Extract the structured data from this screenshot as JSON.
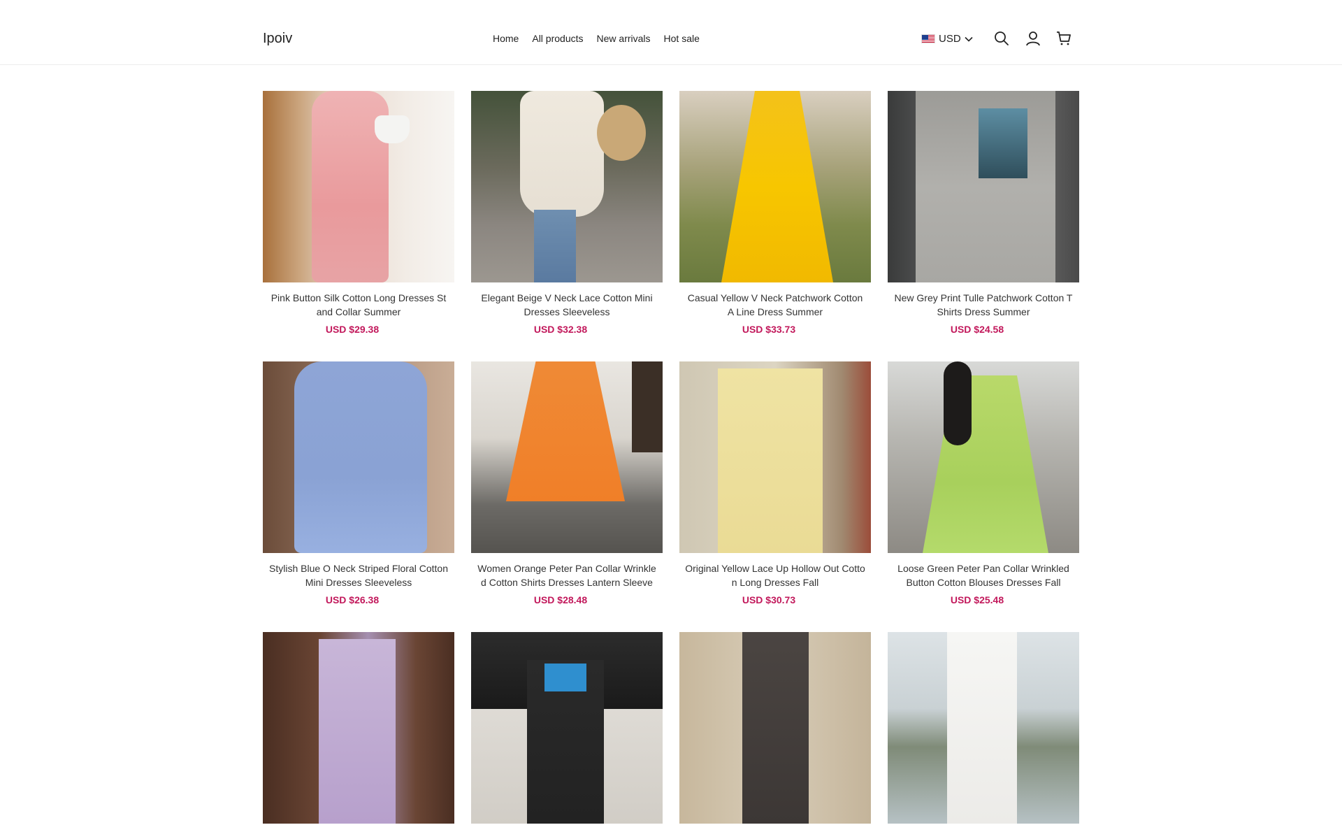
{
  "header": {
    "logo": "Ipoiv",
    "nav": [
      "Home",
      "All products",
      "New arrivals",
      "Hot sale"
    ],
    "currency": "USD",
    "icons": [
      "search-icon",
      "account-icon",
      "cart-icon"
    ]
  },
  "products": [
    {
      "title": "Pink Button Silk Cotton Long Dresses Stand Collar Summer",
      "price": "USD $29.38"
    },
    {
      "title": "Elegant Beige V Neck Lace Cotton Mini Dresses Sleeveless",
      "price": "USD $32.38"
    },
    {
      "title": "Casual Yellow V Neck Patchwork Cotton A Line Dress Summer",
      "price": "USD $33.73"
    },
    {
      "title": "New Grey Print Tulle Patchwork Cotton T Shirts Dress Summer",
      "price": "USD $24.58"
    },
    {
      "title": "Stylish Blue O Neck Striped Floral Cotton Mini Dresses Sleeveless",
      "price": "USD $26.38"
    },
    {
      "title": "Women Orange Peter Pan Collar Wrinkled Cotton Shirts Dresses Lantern Sleeve",
      "price": "USD $28.48"
    },
    {
      "title": "Original Yellow Lace Up Hollow Out Cotton Long Dresses Fall",
      "price": "USD $30.73"
    },
    {
      "title": "Loose Green Peter Pan Collar Wrinkled Button Cotton Blouses Dresses Fall",
      "price": "USD $25.48"
    },
    {
      "title": "",
      "price": ""
    },
    {
      "title": "",
      "price": ""
    },
    {
      "title": "",
      "price": ""
    },
    {
      "title": "",
      "price": ""
    }
  ],
  "colors": {
    "price": "#c2185b",
    "border": "#ececec"
  }
}
